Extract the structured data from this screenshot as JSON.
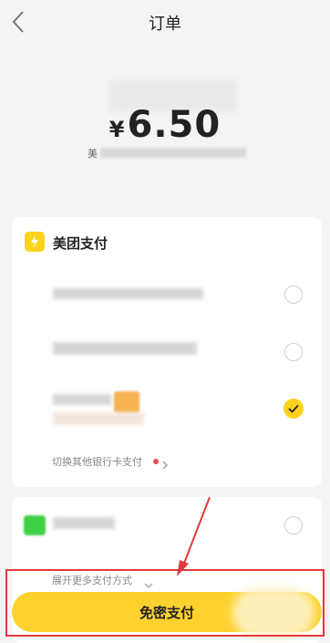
{
  "header": {
    "title": "订单"
  },
  "order": {
    "currency_symbol": "¥",
    "amount": "6.50",
    "merchant_prefix": "美"
  },
  "meituan_pay": {
    "title": "美团支付",
    "switch_card_text": "切换其他银行卡支付",
    "selected_index": 2
  },
  "other_methods": {
    "expand_text": "展开更多支付方式"
  },
  "pay_button": {
    "label": "免密支付"
  },
  "colors": {
    "brand_yellow": "#fdd22f",
    "annotation_red": "#e23a3a",
    "dot_red": "#ef4c4c"
  }
}
